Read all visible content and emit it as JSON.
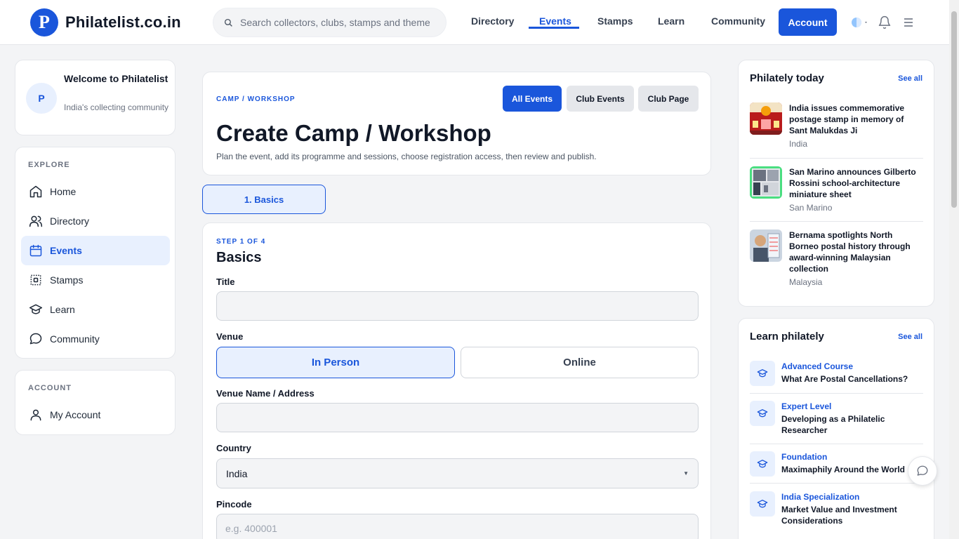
{
  "header": {
    "logo_letter": "P",
    "site_name": "Philatelist.co.in",
    "search_placeholder": "Search collectors, clubs, stamps and themes",
    "nav": [
      "Directory",
      "Events",
      "Stamps",
      "Learn",
      "Community"
    ],
    "active_nav": "Events",
    "account_label": "Account"
  },
  "welcome": {
    "avatar_letter": "P",
    "title": "Welcome to Philatelist",
    "subtitle": "India's collecting community"
  },
  "explore": {
    "label": "EXPLORE",
    "items": [
      {
        "label": "Home",
        "icon": "home-icon"
      },
      {
        "label": "Directory",
        "icon": "users-icon"
      },
      {
        "label": "Events",
        "icon": "calendar-icon"
      },
      {
        "label": "Stamps",
        "icon": "stamp-icon"
      },
      {
        "label": "Learn",
        "icon": "graduation-cap-icon"
      },
      {
        "label": "Community",
        "icon": "chat-bubble-icon"
      }
    ],
    "active": "Events"
  },
  "account_section": {
    "label": "ACCOUNT",
    "item": "My Account"
  },
  "main": {
    "eyebrow": "CAMP / WORKSHOP",
    "tabs": [
      "All Events",
      "Club Events",
      "Club Page"
    ],
    "title": "Create Camp / Workshop",
    "description": "Plan the event, add its programme and sessions, choose registration access, then review and publish.",
    "step_pill": "1. Basics"
  },
  "form": {
    "step_label": "STEP 1 OF 4",
    "title": "Basics",
    "title_label": "Title",
    "title_value": "",
    "venue_label": "Venue",
    "venue_options": [
      "In Person",
      "Online"
    ],
    "venue_selected": "In Person",
    "venue_name_label": "Venue Name / Address",
    "venue_name_value": "",
    "country_label": "Country",
    "country_value": "India",
    "pincode_label": "Pincode",
    "pincode_placeholder": "e.g. 400001"
  },
  "philately_today": {
    "title": "Philately today",
    "see_all": "See all",
    "items": [
      {
        "title": "India issues commemorative postage stamp in memory of Sant Malukdas Ji",
        "country": "India"
      },
      {
        "title": "San Marino announces Gilberto Rossini school-architecture miniature sheet",
        "country": "San Marino"
      },
      {
        "title": "Bernama spotlights North Borneo postal history through award-winning Malaysian collection",
        "country": "Malaysia"
      }
    ]
  },
  "learn_philately": {
    "title": "Learn philately",
    "see_all": "See all",
    "items": [
      {
        "level": "Advanced Course",
        "title": "What Are Postal Cancellations?"
      },
      {
        "level": "Expert Level",
        "title": "Developing as a Philatelic Researcher"
      },
      {
        "level": "Foundation",
        "title": "Maximaphily Around the World"
      },
      {
        "level": "India Specialization",
        "title": "Market Value and Investment Considerations"
      }
    ]
  },
  "colors": {
    "accent": "#1a56db",
    "accent_light": "#e8f0fe",
    "background": "#f3f4f6"
  }
}
